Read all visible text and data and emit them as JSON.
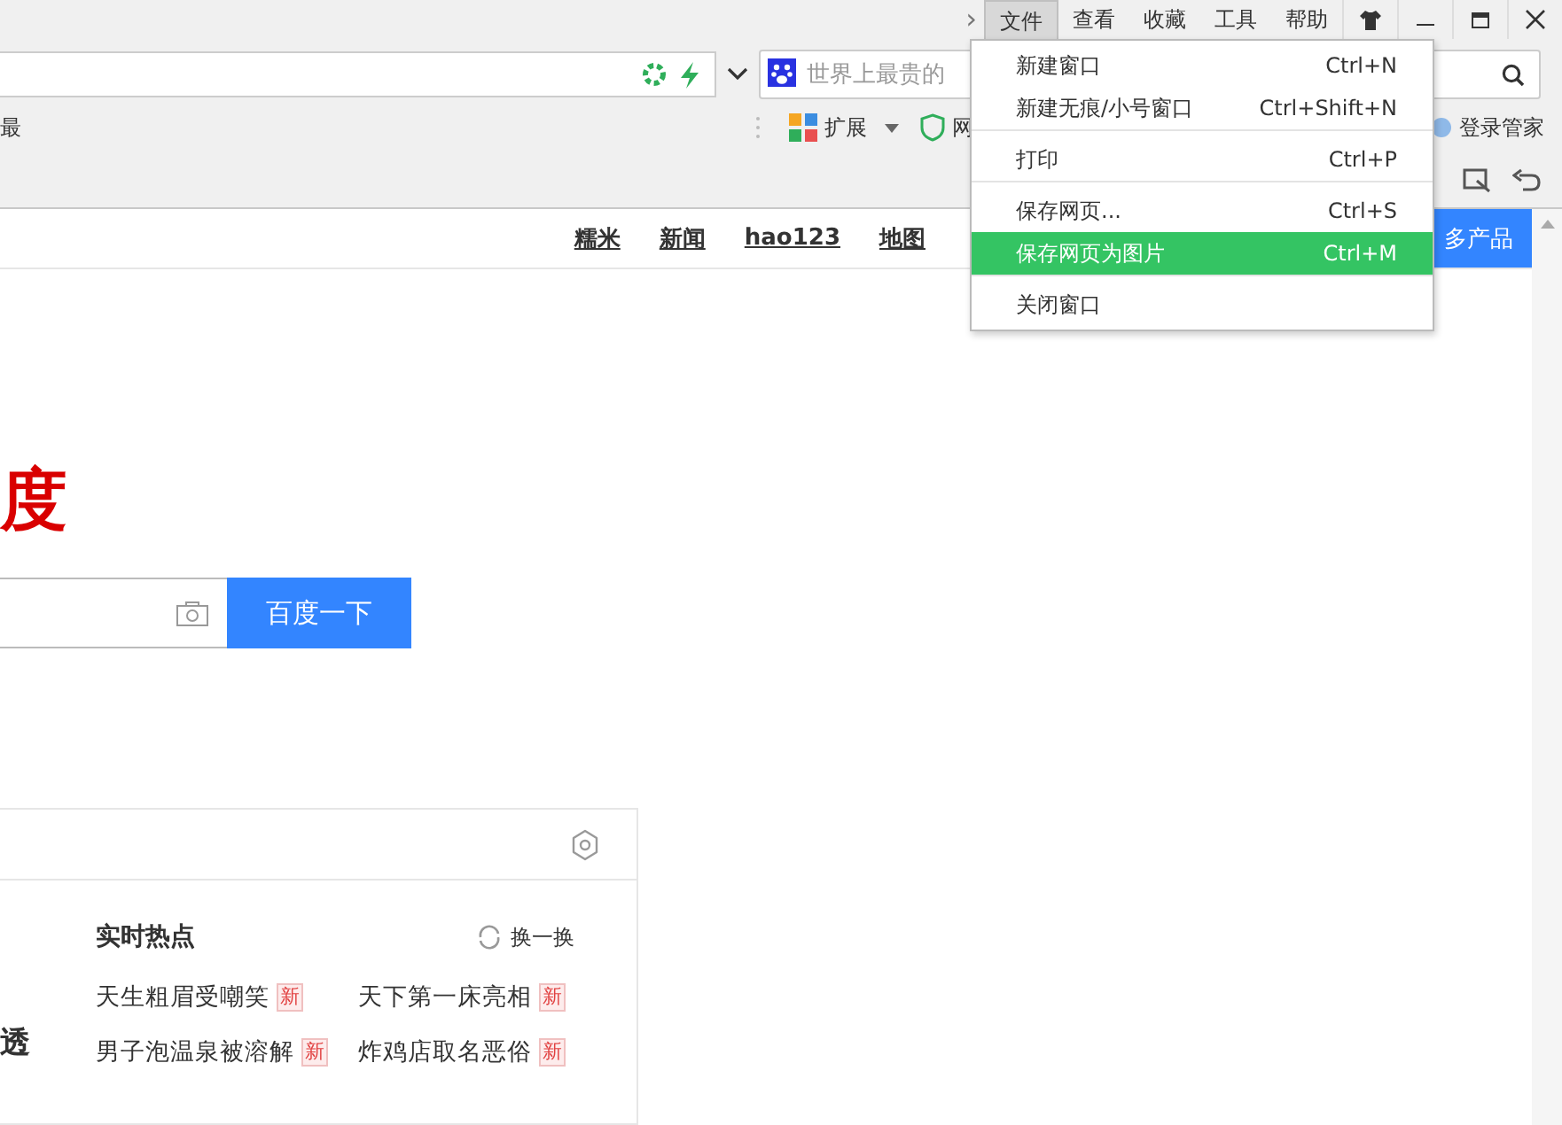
{
  "menubar": {
    "overflow_glyph": "›",
    "items": [
      {
        "label": "文件",
        "selected": true
      },
      {
        "label": "查看",
        "selected": false
      },
      {
        "label": "收藏",
        "selected": false
      },
      {
        "label": "工具",
        "selected": false
      },
      {
        "label": "帮助",
        "selected": false
      }
    ]
  },
  "search_box": {
    "placeholder": "世界上最贵的"
  },
  "bookmarks": {
    "left_text": "最",
    "extensions_label": "扩展",
    "shield_label": "网",
    "login_label": "登录管家"
  },
  "file_menu": {
    "items": [
      {
        "label": "新建窗口",
        "shortcut": "Ctrl+N",
        "selected": false,
        "separator_after": false
      },
      {
        "label": "新建无痕/小号窗口",
        "shortcut": "Ctrl+Shift+N",
        "selected": false,
        "separator_after": true
      },
      {
        "label": "打印",
        "shortcut": "Ctrl+P",
        "selected": false,
        "separator_after": true
      },
      {
        "label": "保存网页...",
        "shortcut": "Ctrl+S",
        "selected": false,
        "separator_after": false
      },
      {
        "label": "保存网页为图片",
        "shortcut": "Ctrl+M",
        "selected": true,
        "separator_after": true
      },
      {
        "label": "关闭窗口",
        "selected": false,
        "separator_after": false
      }
    ]
  },
  "page": {
    "nav_links": [
      "糯米",
      "新闻",
      "hao123",
      "地图"
    ],
    "more_button": "多产品",
    "logo_text": "度",
    "search_button": "百度一下",
    "left_partial_text": "透",
    "hot": {
      "title": "实时热点",
      "refresh": "换一换",
      "items": [
        {
          "text": "天生粗眉受嘲笑",
          "badge": "新"
        },
        {
          "text": "天下第一床亮相",
          "badge": "新"
        },
        {
          "text": "男子泡温泉被溶解",
          "badge": "新"
        },
        {
          "text": "炸鸡店取名恶俗",
          "badge": "新"
        }
      ]
    }
  }
}
